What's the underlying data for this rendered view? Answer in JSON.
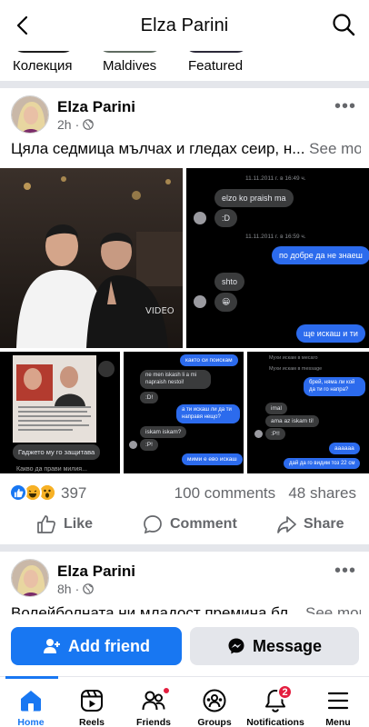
{
  "header": {
    "title": "Elza Parini"
  },
  "highlights": [
    {
      "label": "Колекция",
      "color": "#1c1c1c"
    },
    {
      "label": "Maldives",
      "color": "#5f6b61"
    },
    {
      "label": "Featured",
      "color": "#2a2838"
    }
  ],
  "post1": {
    "author": "Elza Parini",
    "time": "2h",
    "text": "Цяла седмица мълчах и гледах сеир, н...",
    "see_more": "See more",
    "chat_main": {
      "ts1": "11.11.2011 г. в 16:49 ч.",
      "m1": "elzo ko praish ma",
      "m2": ":D",
      "ts2": "11.11.2011 г. в 16:59 ч.",
      "m3": "по добре да не знаеш",
      "m4": "shto",
      "m5": "😀",
      "m6": "ще искаш и ти"
    },
    "chat_a": {
      "caption": "Гаджето му го защитава",
      "caption2": "Какво да прави милия..."
    },
    "chat_b": {
      "m1": "както си поискам",
      "m2": "ne men iskash li a mi napraish nestoi!",
      "m3": ":D!",
      "m4": "а ти искаш ли да ти направя нещо?",
      "m5": "iskam iskam?",
      "m6": ":P!",
      "m7": "мими е ево искаш"
    },
    "chat_c": {
      "ts1": "Мухи искам в месаго",
      "ts2": "Мухи искам в message",
      "m1": "брей, няма ли кой да ти го напра?",
      "m2": "imal",
      "m3": "ama az iskam ti!",
      "m4": ":P!!",
      "m5": "аааааа",
      "m6": "дай да го видим тоз 22 см"
    },
    "reaction_count": "397",
    "comments": "100 comments",
    "shares": "48 shares",
    "actions": {
      "like": "Like",
      "comment": "Comment",
      "share": "Share"
    }
  },
  "post2": {
    "author": "Elza Parini",
    "time": "8h",
    "text": "Волейболната ни младост премина бл...",
    "see_more": "See more"
  },
  "buttons": {
    "add_friend": "Add friend",
    "message": "Message"
  },
  "tabs": [
    {
      "label": "Home",
      "icon": "home-icon",
      "active": true
    },
    {
      "label": "Reels",
      "icon": "reels-icon"
    },
    {
      "label": "Friends",
      "icon": "friends-icon"
    },
    {
      "label": "Groups",
      "icon": "groups-icon"
    },
    {
      "label": "Notifications",
      "icon": "bell-icon",
      "badge": "2"
    },
    {
      "label": "Menu",
      "icon": "menu-icon"
    }
  ],
  "colors": {
    "accent": "#1877f2",
    "badge": "#e41e3f",
    "bubble_blue": "#2c6bed"
  }
}
